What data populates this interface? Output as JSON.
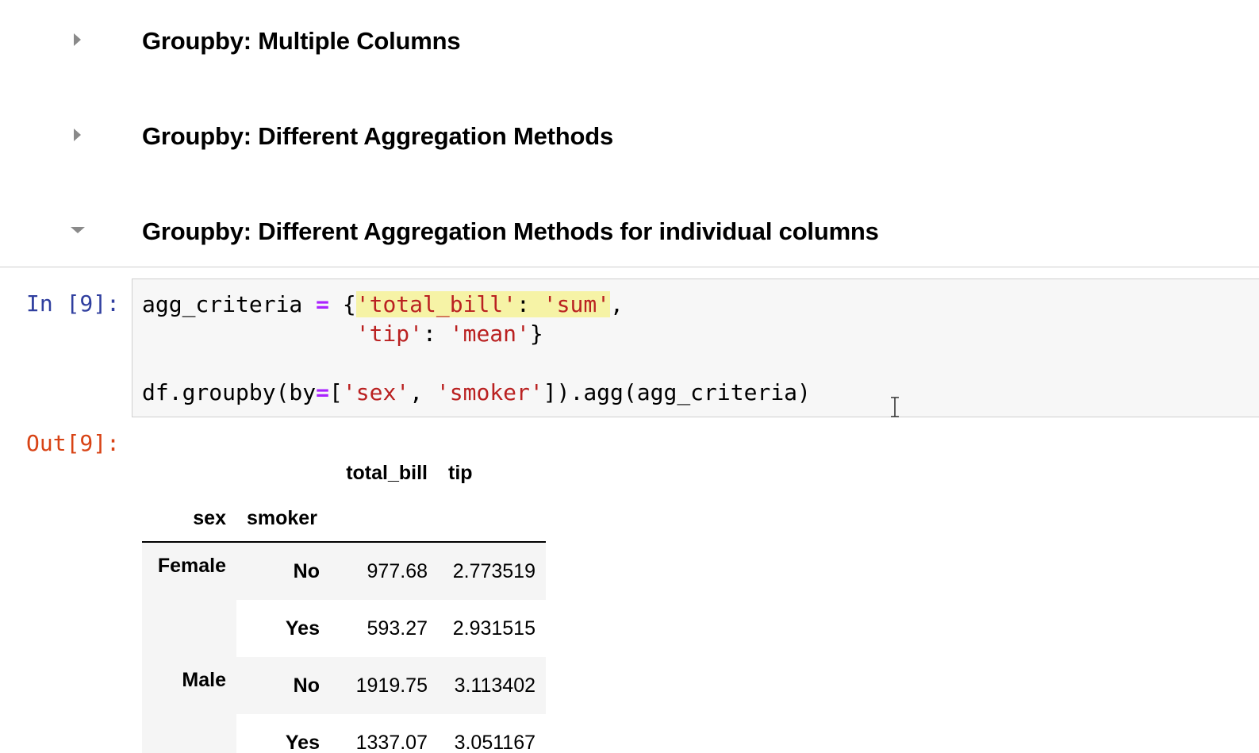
{
  "headings": [
    {
      "text": "Groupby: Multiple Columns",
      "state": "collapsed"
    },
    {
      "text": "Groupby: Different Aggregation Methods",
      "state": "collapsed"
    },
    {
      "text": "Groupby: Different Aggregation Methods for individual columns",
      "state": "expanded"
    }
  ],
  "code_cell": {
    "prompt": "In [9]:",
    "lines": [
      "agg_criteria = {'total_bill': 'sum',",
      "                'tip': 'mean'}",
      "",
      "df.groupby(by=['sex', 'smoker']).agg(agg_criteria)"
    ],
    "highlighted_token": "'total_bill': 'sum'"
  },
  "output": {
    "prompt": "Out[9]:",
    "table": {
      "columns": [
        "total_bill",
        "tip"
      ],
      "index_names": [
        "sex",
        "smoker"
      ],
      "rows": [
        {
          "sex": "Female",
          "smoker": "No",
          "total_bill": "977.68",
          "tip": "2.773519"
        },
        {
          "sex": "",
          "smoker": "Yes",
          "total_bill": "593.27",
          "tip": "2.931515"
        },
        {
          "sex": "Male",
          "smoker": "No",
          "total_bill": "1919.75",
          "tip": "3.113402"
        },
        {
          "sex": "",
          "smoker": "Yes",
          "total_bill": "1337.07",
          "tip": "3.051167"
        }
      ]
    }
  },
  "colors": {
    "in_prompt": "#303f9f",
    "out_prompt": "#d84315",
    "string": "#ba2121",
    "operator": "#aa22ff",
    "highlight": "#f6f3a6",
    "cell_background": "#f7f7f7"
  },
  "icons": {
    "collapsed": "caret-right-icon",
    "expanded": "caret-down-icon",
    "cursor": "text-cursor-icon"
  }
}
